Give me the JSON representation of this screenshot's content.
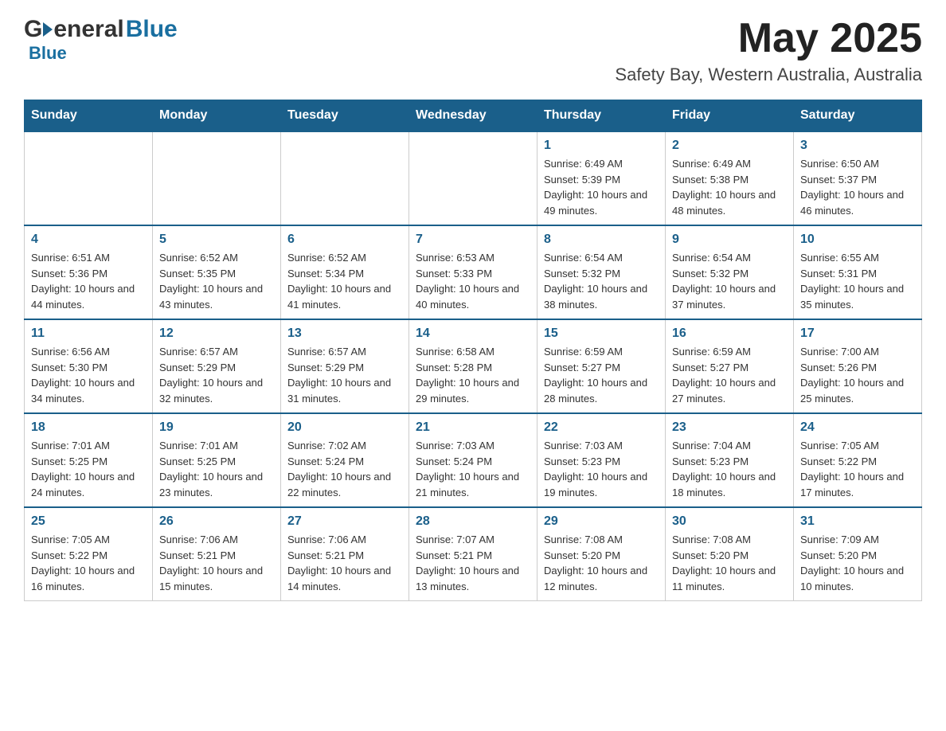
{
  "header": {
    "logo_general": "General",
    "logo_blue": "Blue",
    "month_title": "May 2025",
    "location": "Safety Bay, Western Australia, Australia"
  },
  "calendar": {
    "days_of_week": [
      "Sunday",
      "Monday",
      "Tuesday",
      "Wednesday",
      "Thursday",
      "Friday",
      "Saturday"
    ],
    "weeks": [
      [
        {
          "day": "",
          "info": ""
        },
        {
          "day": "",
          "info": ""
        },
        {
          "day": "",
          "info": ""
        },
        {
          "day": "",
          "info": ""
        },
        {
          "day": "1",
          "info": "Sunrise: 6:49 AM\nSunset: 5:39 PM\nDaylight: 10 hours and 49 minutes."
        },
        {
          "day": "2",
          "info": "Sunrise: 6:49 AM\nSunset: 5:38 PM\nDaylight: 10 hours and 48 minutes."
        },
        {
          "day": "3",
          "info": "Sunrise: 6:50 AM\nSunset: 5:37 PM\nDaylight: 10 hours and 46 minutes."
        }
      ],
      [
        {
          "day": "4",
          "info": "Sunrise: 6:51 AM\nSunset: 5:36 PM\nDaylight: 10 hours and 44 minutes."
        },
        {
          "day": "5",
          "info": "Sunrise: 6:52 AM\nSunset: 5:35 PM\nDaylight: 10 hours and 43 minutes."
        },
        {
          "day": "6",
          "info": "Sunrise: 6:52 AM\nSunset: 5:34 PM\nDaylight: 10 hours and 41 minutes."
        },
        {
          "day": "7",
          "info": "Sunrise: 6:53 AM\nSunset: 5:33 PM\nDaylight: 10 hours and 40 minutes."
        },
        {
          "day": "8",
          "info": "Sunrise: 6:54 AM\nSunset: 5:32 PM\nDaylight: 10 hours and 38 minutes."
        },
        {
          "day": "9",
          "info": "Sunrise: 6:54 AM\nSunset: 5:32 PM\nDaylight: 10 hours and 37 minutes."
        },
        {
          "day": "10",
          "info": "Sunrise: 6:55 AM\nSunset: 5:31 PM\nDaylight: 10 hours and 35 minutes."
        }
      ],
      [
        {
          "day": "11",
          "info": "Sunrise: 6:56 AM\nSunset: 5:30 PM\nDaylight: 10 hours and 34 minutes."
        },
        {
          "day": "12",
          "info": "Sunrise: 6:57 AM\nSunset: 5:29 PM\nDaylight: 10 hours and 32 minutes."
        },
        {
          "day": "13",
          "info": "Sunrise: 6:57 AM\nSunset: 5:29 PM\nDaylight: 10 hours and 31 minutes."
        },
        {
          "day": "14",
          "info": "Sunrise: 6:58 AM\nSunset: 5:28 PM\nDaylight: 10 hours and 29 minutes."
        },
        {
          "day": "15",
          "info": "Sunrise: 6:59 AM\nSunset: 5:27 PM\nDaylight: 10 hours and 28 minutes."
        },
        {
          "day": "16",
          "info": "Sunrise: 6:59 AM\nSunset: 5:27 PM\nDaylight: 10 hours and 27 minutes."
        },
        {
          "day": "17",
          "info": "Sunrise: 7:00 AM\nSunset: 5:26 PM\nDaylight: 10 hours and 25 minutes."
        }
      ],
      [
        {
          "day": "18",
          "info": "Sunrise: 7:01 AM\nSunset: 5:25 PM\nDaylight: 10 hours and 24 minutes."
        },
        {
          "day": "19",
          "info": "Sunrise: 7:01 AM\nSunset: 5:25 PM\nDaylight: 10 hours and 23 minutes."
        },
        {
          "day": "20",
          "info": "Sunrise: 7:02 AM\nSunset: 5:24 PM\nDaylight: 10 hours and 22 minutes."
        },
        {
          "day": "21",
          "info": "Sunrise: 7:03 AM\nSunset: 5:24 PM\nDaylight: 10 hours and 21 minutes."
        },
        {
          "day": "22",
          "info": "Sunrise: 7:03 AM\nSunset: 5:23 PM\nDaylight: 10 hours and 19 minutes."
        },
        {
          "day": "23",
          "info": "Sunrise: 7:04 AM\nSunset: 5:23 PM\nDaylight: 10 hours and 18 minutes."
        },
        {
          "day": "24",
          "info": "Sunrise: 7:05 AM\nSunset: 5:22 PM\nDaylight: 10 hours and 17 minutes."
        }
      ],
      [
        {
          "day": "25",
          "info": "Sunrise: 7:05 AM\nSunset: 5:22 PM\nDaylight: 10 hours and 16 minutes."
        },
        {
          "day": "26",
          "info": "Sunrise: 7:06 AM\nSunset: 5:21 PM\nDaylight: 10 hours and 15 minutes."
        },
        {
          "day": "27",
          "info": "Sunrise: 7:06 AM\nSunset: 5:21 PM\nDaylight: 10 hours and 14 minutes."
        },
        {
          "day": "28",
          "info": "Sunrise: 7:07 AM\nSunset: 5:21 PM\nDaylight: 10 hours and 13 minutes."
        },
        {
          "day": "29",
          "info": "Sunrise: 7:08 AM\nSunset: 5:20 PM\nDaylight: 10 hours and 12 minutes."
        },
        {
          "day": "30",
          "info": "Sunrise: 7:08 AM\nSunset: 5:20 PM\nDaylight: 10 hours and 11 minutes."
        },
        {
          "day": "31",
          "info": "Sunrise: 7:09 AM\nSunset: 5:20 PM\nDaylight: 10 hours and 10 minutes."
        }
      ]
    ]
  }
}
